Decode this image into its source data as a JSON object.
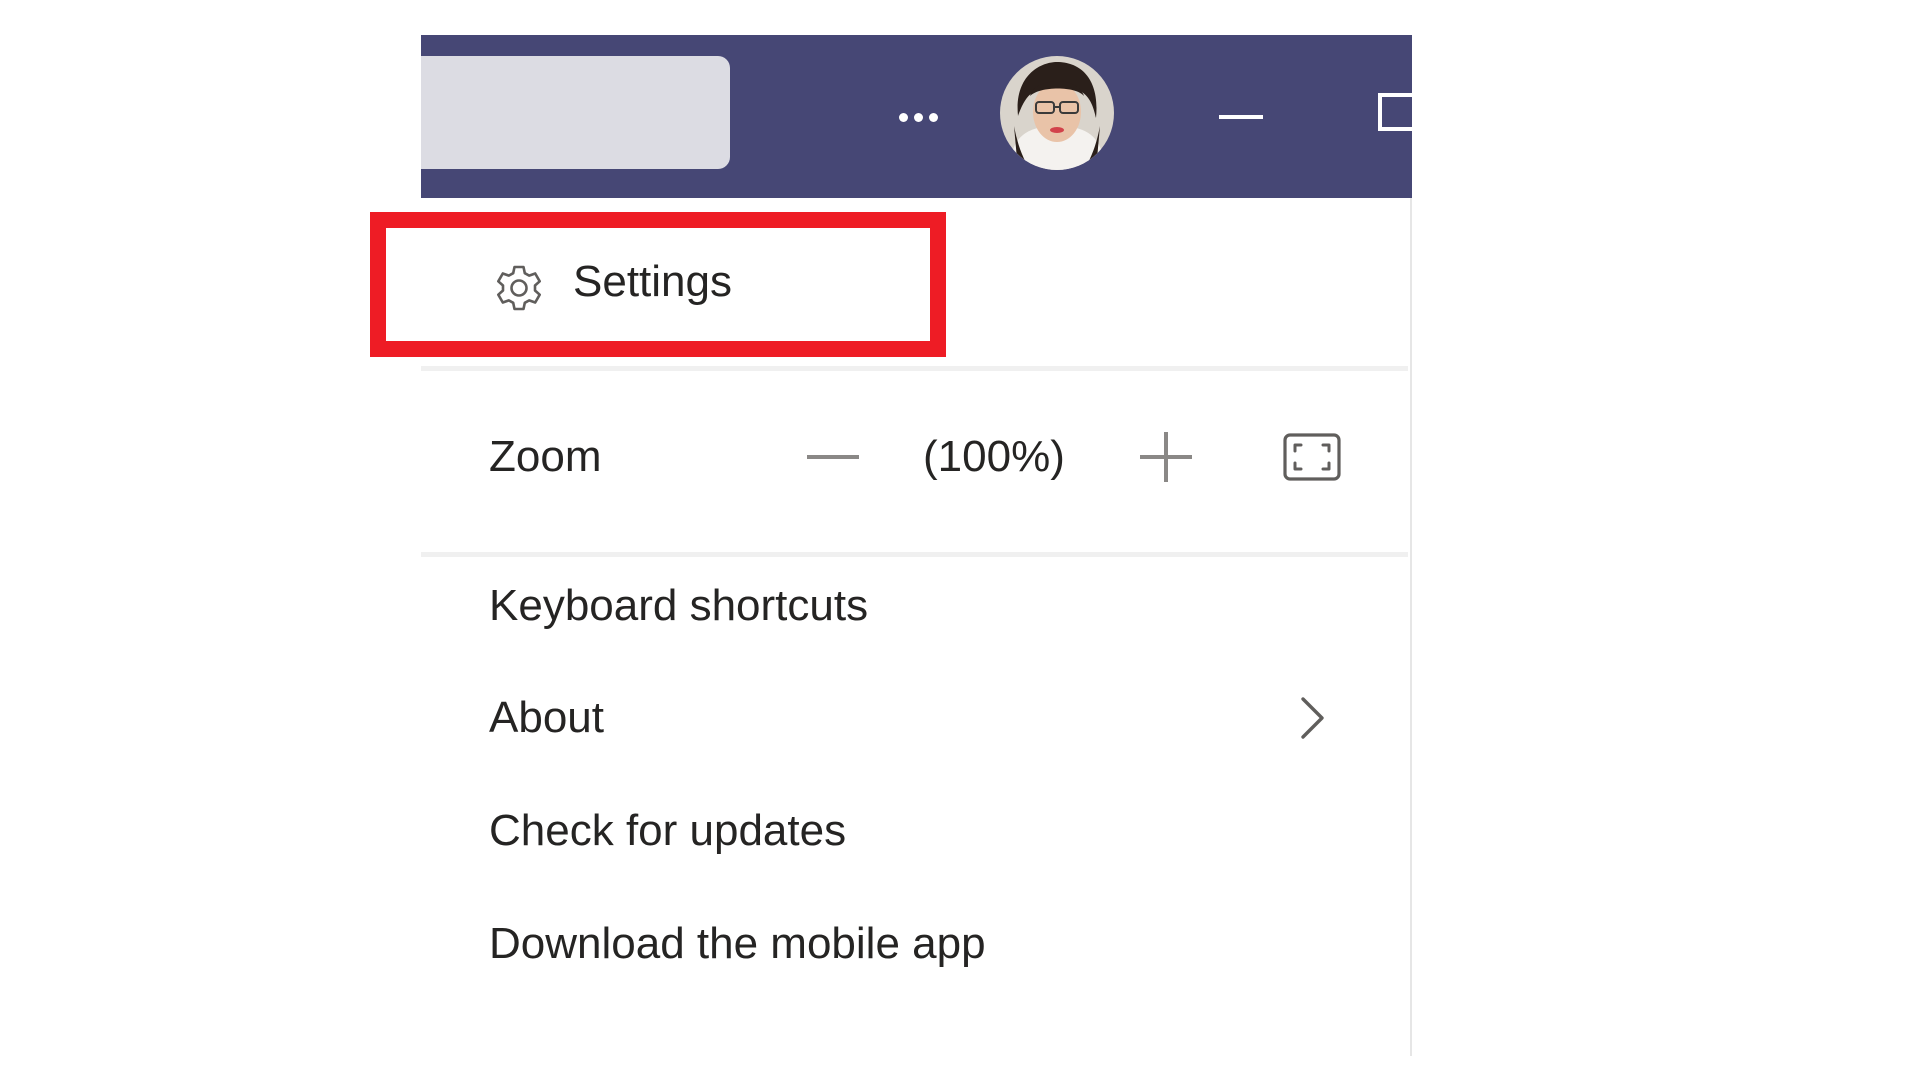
{
  "titlebar": {
    "background_color": "#464775",
    "search_box_color": "#dcdce3",
    "more_icon": "ellipsis-icon",
    "avatar_status": "available",
    "status_color": "#92c353"
  },
  "menu": {
    "settings_label": "Settings",
    "settings_icon": "gear-icon",
    "zoom": {
      "label": "Zoom",
      "value": "(100%)"
    },
    "keyboard_shortcuts_label": "Keyboard shortcuts",
    "about_label": "About",
    "check_updates_label": "Check for updates",
    "download_app_label": "Download the mobile app"
  },
  "highlight": {
    "color": "#ee1c25",
    "target": "settings"
  }
}
